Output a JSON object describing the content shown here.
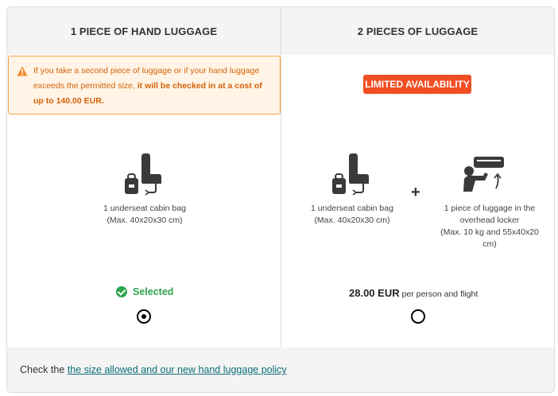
{
  "columns": [
    {
      "header": "1 PIECE OF HAND LUGGAGE",
      "warning": {
        "text_plain": "If you take a second piece of luggage or if your hand luggage exceeds the permitted size, ",
        "text_bold": "it will be checked in at a cost of up to 140.00 EUR."
      },
      "items": [
        {
          "icon": "underseat-bag-icon",
          "caption_line1": "1 underseat cabin bag",
          "caption_line2": "(Max. 40x20x30 cm)"
        }
      ],
      "status": "Selected",
      "selected": true
    },
    {
      "header": "2 PIECES OF LUGGAGE",
      "badge": "LIMITED AVAILABILITY",
      "items": [
        {
          "icon": "underseat-bag-icon",
          "caption_line1": "1 underseat cabin bag",
          "caption_line2": "(Max. 40x20x30 cm)"
        },
        {
          "icon": "overhead-locker-icon",
          "caption_line1": "1 piece of luggage in the",
          "caption_line2": "overhead locker",
          "caption_line3": "(Max. 10 kg and 55x40x20",
          "caption_line4": "cm)"
        }
      ],
      "plus": "+",
      "price": "28.00 EUR",
      "price_note": "per person and flight",
      "selected": false
    }
  ],
  "footer": {
    "prefix": "Check the",
    "link": "the size allowed and our new hand luggage policy"
  },
  "colors": {
    "warning_text": "#d4610a",
    "warning_bg": "#fff4e5",
    "badge_bg": "#f04e23",
    "selected_green": "#2ea44f",
    "link": "#0b6e79"
  }
}
